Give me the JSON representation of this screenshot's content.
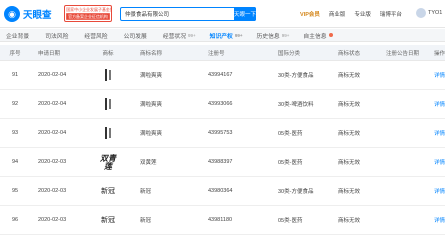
{
  "header": {
    "logo_text": "天眼查",
    "promo_line1": "国家中小企业发展子基金旗下",
    "promo_line2": "官方备案企业征信机构",
    "search_value": "仲景食品有限公司",
    "search_button": "天眼一下",
    "nav": [
      "VIP会员",
      "商业版",
      "专业版",
      "瑞博平台"
    ],
    "user_name": "TYO1"
  },
  "tabs": [
    {
      "label": "企业背景",
      "count": ""
    },
    {
      "label": "司法风险",
      "count": ""
    },
    {
      "label": "经营风险",
      "count": ""
    },
    {
      "label": "公司发展",
      "count": ""
    },
    {
      "label": "经营状况",
      "count": "99+"
    },
    {
      "label": "知识产权",
      "count": "99+",
      "active": true
    },
    {
      "label": "历史信息",
      "count": "99+"
    },
    {
      "label": "自主信息",
      "count": ""
    }
  ],
  "table": {
    "columns": [
      "序号",
      "申请日期",
      "商标",
      "商标名称",
      "注册号",
      "国际分类",
      "商标状态",
      "注册公告日期",
      "操作"
    ],
    "rows": [
      {
        "no": "91",
        "date": "2020-02-04",
        "mark": "bar",
        "name": "满啦爽爽",
        "reg": "43994167",
        "class": "30类-方便食品",
        "status": "商标无效",
        "notice": "",
        "action": "详情"
      },
      {
        "no": "92",
        "date": "2020-02-04",
        "mark": "bar",
        "name": "满啦爽爽",
        "reg": "43993066",
        "class": "30类-啤酒饮料",
        "status": "商标无效",
        "notice": "",
        "action": "详情"
      },
      {
        "no": "93",
        "date": "2020-02-04",
        "mark": "bar",
        "name": "满啦爽爽",
        "reg": "43995753",
        "class": "05类-医药",
        "status": "商标无效",
        "notice": "",
        "action": "详情"
      },
      {
        "no": "94",
        "date": "2020-02-03",
        "mark": "calligraphy",
        "mark_text": "双青莲",
        "name": "双黄莲",
        "reg": "43988397",
        "class": "05类-医药",
        "status": "商标无效",
        "notice": "",
        "action": "详情"
      },
      {
        "no": "95",
        "date": "2020-02-03",
        "mark": "text",
        "mark_text": "新冠",
        "name": "新冠",
        "reg": "43980364",
        "class": "30类-方便食品",
        "status": "商标无效",
        "notice": "",
        "action": "详情"
      },
      {
        "no": "96",
        "date": "2020-02-03",
        "mark": "text",
        "mark_text": "新冠",
        "name": "新冠",
        "reg": "43981180",
        "class": "05类-医药",
        "status": "商标无效",
        "notice": "",
        "action": "详情"
      }
    ]
  },
  "colors": {
    "brand": "#0084ff",
    "promo_red": "#e84a3a",
    "vip_gold": "#d4861a",
    "header_bg": "#f1f4f8"
  }
}
